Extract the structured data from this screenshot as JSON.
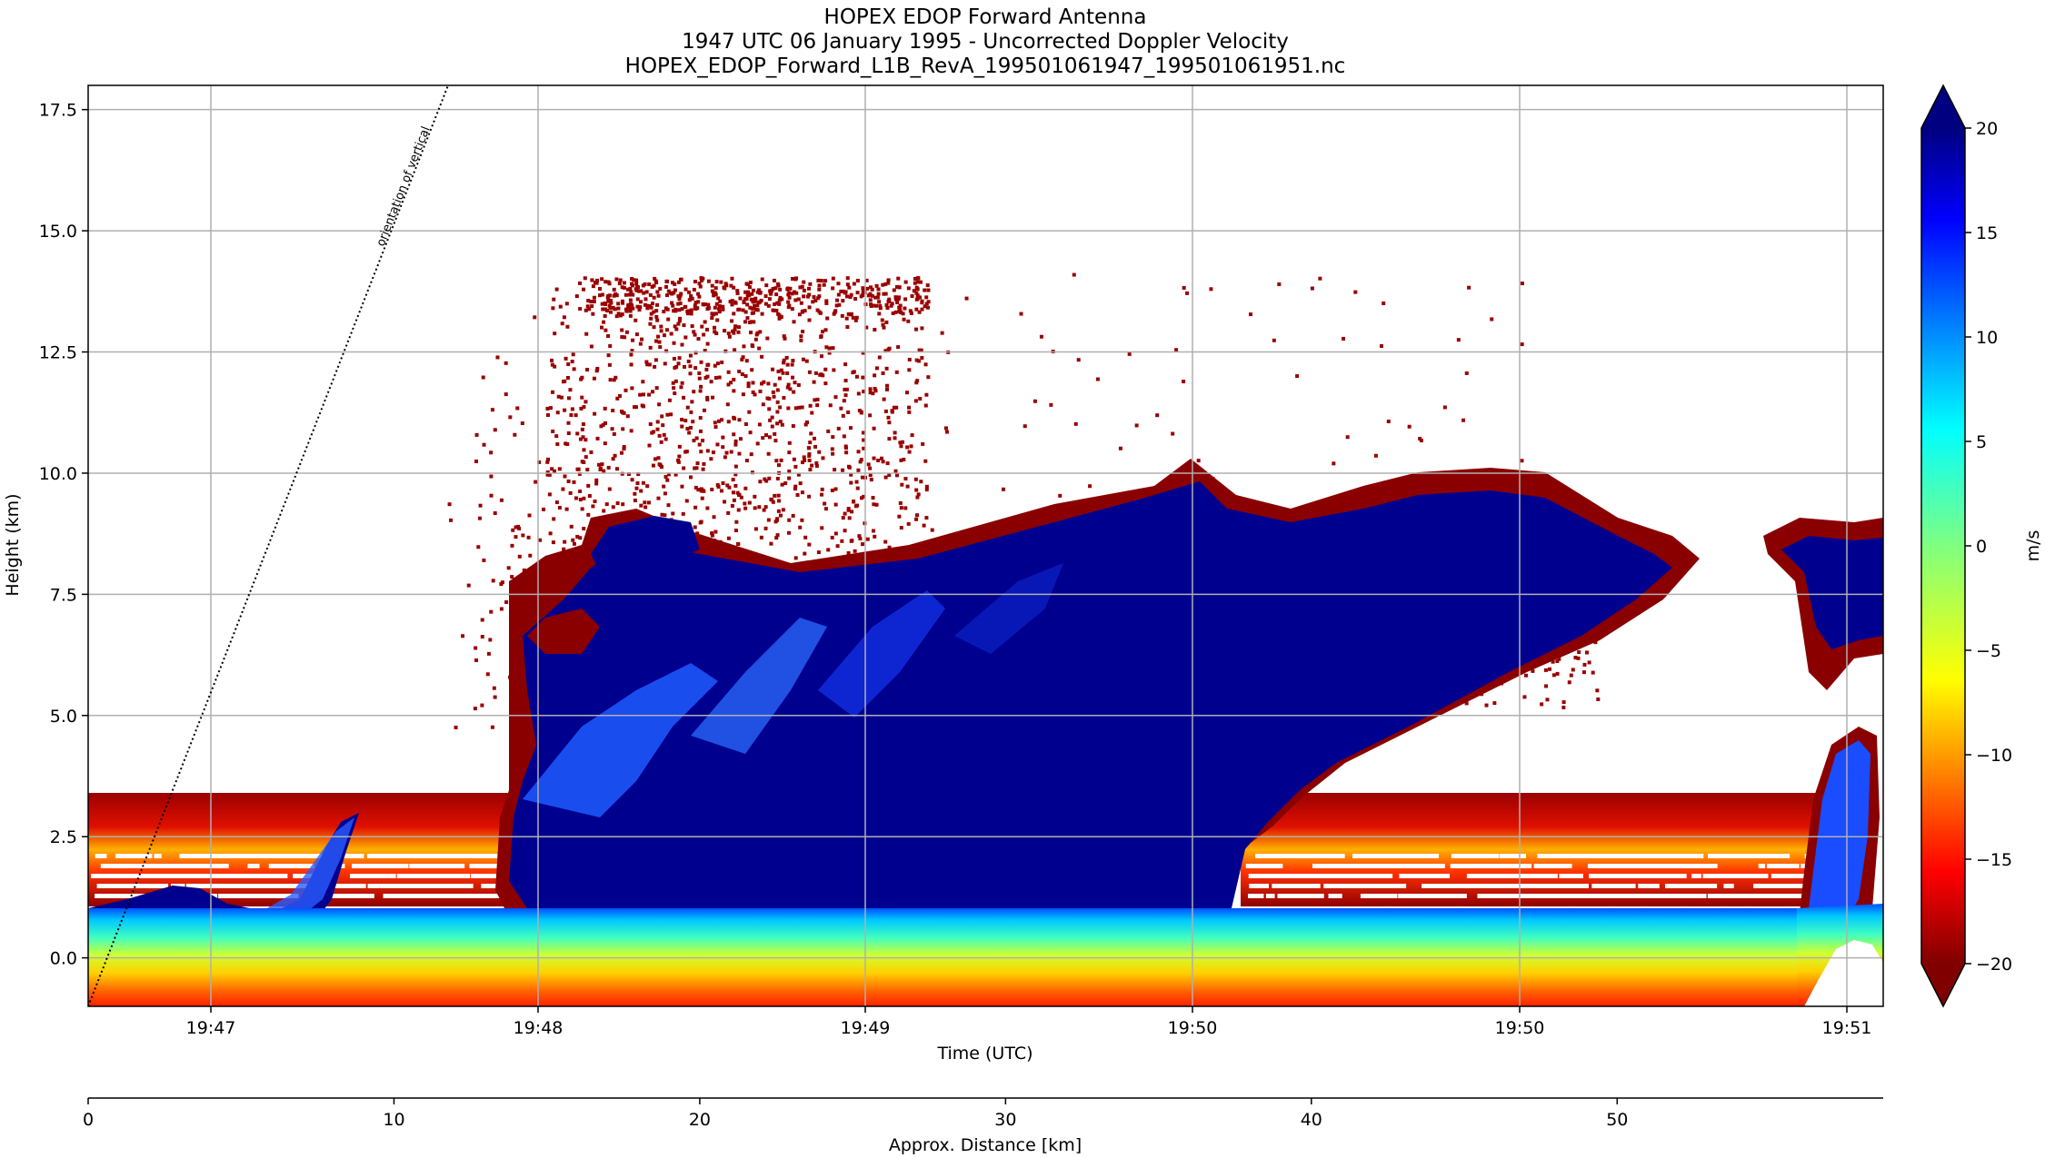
{
  "figure": {
    "title_lines": [
      "HOPEX EDOP Forward Antenna",
      "1947 UTC 06 January 1995 - Uncorrected Doppler Velocity",
      "HOPEX_EDOP_Forward_L1B_RevA_199501061947_199501061951.nc"
    ]
  },
  "chart_data": {
    "type": "heatmap",
    "xlabel": "Time (UTC)",
    "ylabel": "Height (km)",
    "x_tick_labels": [
      "19:47",
      "19:48",
      "19:49",
      "19:50",
      "19:50",
      "19:51"
    ],
    "y_ticks": [
      0.0,
      2.5,
      5.0,
      7.5,
      10.0,
      12.5,
      15.0,
      17.5
    ],
    "y_tick_labels": [
      "0.0",
      "2.5",
      "5.0",
      "7.5",
      "10.0",
      "12.5",
      "15.0",
      "17.5"
    ],
    "ylim": [
      -1.0,
      18.0
    ],
    "grid": true,
    "annotation": "orientation of vertical",
    "secondary_x_axis": {
      "label": "Approx. Distance [km]",
      "ticks": [
        0,
        10,
        20,
        30,
        40,
        50
      ],
      "tick_labels": [
        "0",
        "10",
        "20",
        "30",
        "40",
        "50"
      ],
      "xlim": [
        0,
        58.7
      ]
    },
    "colorbar": {
      "label": "m/s",
      "ticks": [
        -20,
        -15,
        -10,
        -5,
        0,
        5,
        10,
        15,
        20
      ],
      "tick_labels": [
        "−20",
        "−15",
        "−10",
        "−5",
        "0",
        "5",
        "10",
        "15",
        "20"
      ],
      "range": [
        -20,
        20
      ],
      "colormap": "jet",
      "extend": "both"
    },
    "features_velocity_ms": {
      "upper_cloud_core": 20,
      "cloud_edges": -20,
      "near_surface_band": [
        -15,
        10
      ]
    }
  }
}
